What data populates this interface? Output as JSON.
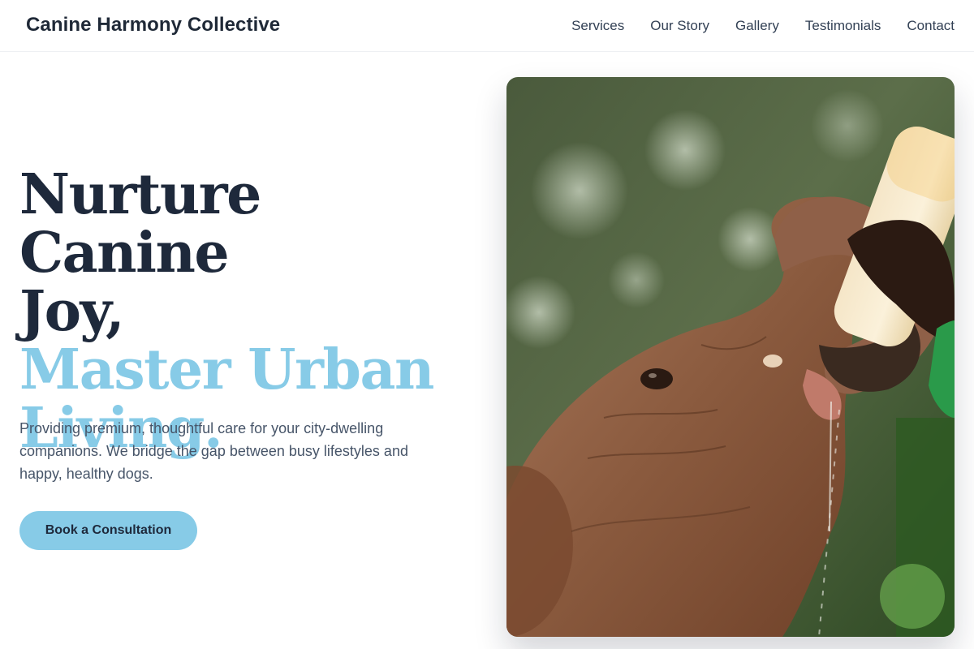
{
  "header": {
    "brand": "Canine Harmony Collective",
    "nav": [
      "Services",
      "Our Story",
      "Gallery",
      "Testimonials",
      "Contact"
    ]
  },
  "hero": {
    "title_line1": "Nurture Canine",
    "title_line2": "Joy,",
    "title_line3": "Master Urban",
    "title_line4": "Living.",
    "description": "Providing premium, thoughtful care for your city-dwelling companions. We bridge the gap between busy lifestyles and happy, healthy dogs.",
    "cta_label": "Book a Consultation",
    "image_alt": "Baby elephant drinking milk from a bottle held by a caretaker"
  },
  "colors": {
    "accent": "#87cbe7",
    "heading": "#1e293b",
    "body_text": "#475569"
  }
}
